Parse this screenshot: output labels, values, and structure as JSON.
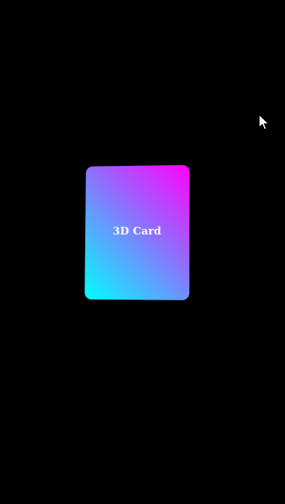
{
  "card": {
    "label": "3D Card",
    "gradient_from": "#00ffff",
    "gradient_to": "#ff00ff"
  },
  "background": "#000000",
  "cursor": {
    "icon": "mouse-pointer-icon"
  }
}
